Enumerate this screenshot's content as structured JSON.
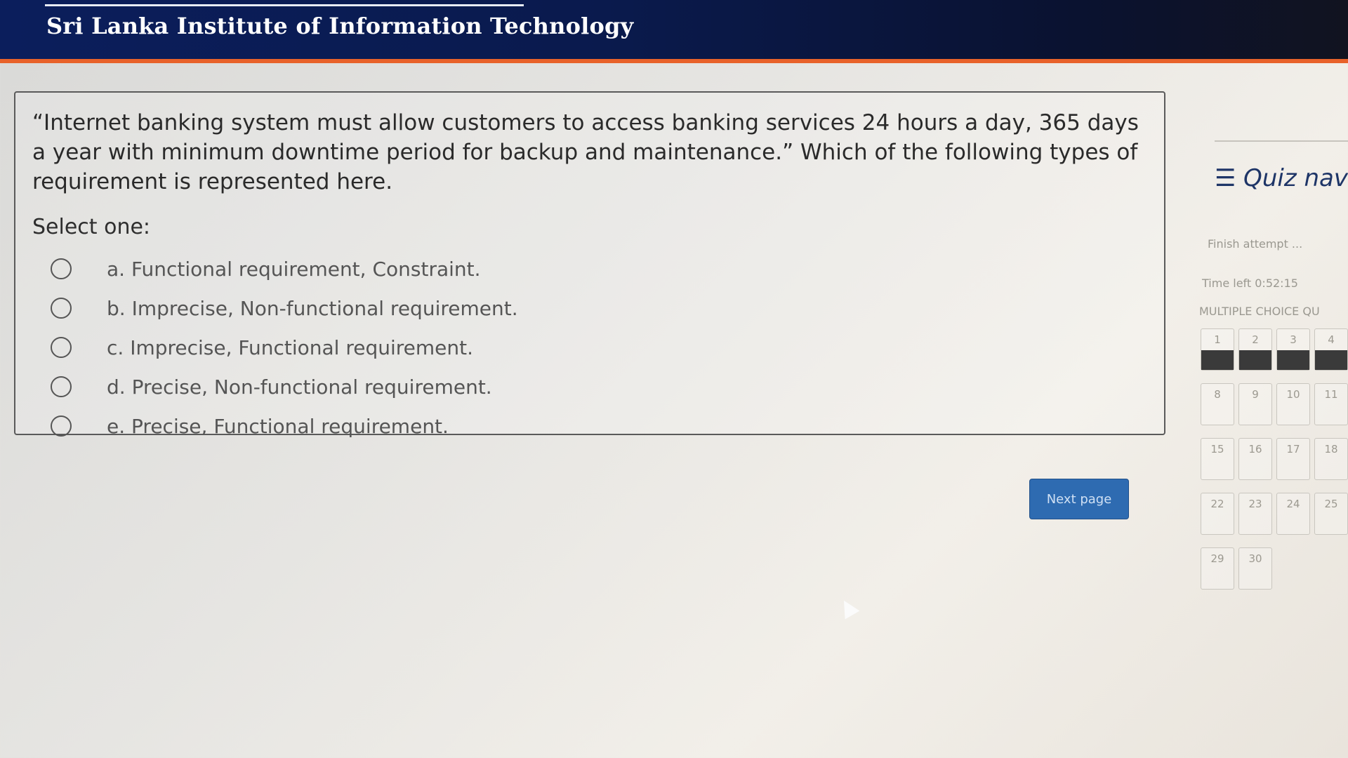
{
  "header": {
    "institution": "Sri Lanka Institute of Information Technology"
  },
  "question": {
    "text": "“Internet banking system must allow customers to access banking services 24 hours a day, 365 days a year with minimum downtime period for backup and maintenance.” Which of the following types of requirement is represented here.",
    "prompt": "Select one:",
    "options": [
      {
        "label": "a. Functional requirement, Constraint."
      },
      {
        "label": "b. Imprecise, Non-functional requirement."
      },
      {
        "label": "c. Imprecise, Functional requirement."
      },
      {
        "label": "d. Precise, Non-functional requirement."
      },
      {
        "label": "e. Precise, Functional requirement."
      }
    ]
  },
  "actions": {
    "next_label": "Next page"
  },
  "quiz_nav": {
    "title": "☰ Quiz naviga",
    "finish_label": "Finish attempt ...",
    "time_left": "Time left 0:52:15",
    "section_label": "MULTIPLE CHOICE QU",
    "rows": [
      [
        "1",
        "2",
        "3",
        "4"
      ],
      [
        "8",
        "9",
        "10",
        "11"
      ],
      [
        "15",
        "16",
        "17",
        "18"
      ],
      [
        "22",
        "23",
        "24",
        "25"
      ],
      [
        "29",
        "30"
      ]
    ]
  },
  "colors": {
    "header_bg": "#0b1e5c",
    "header_accent": "#e8622a",
    "button_bg": "#2e6bb1"
  }
}
